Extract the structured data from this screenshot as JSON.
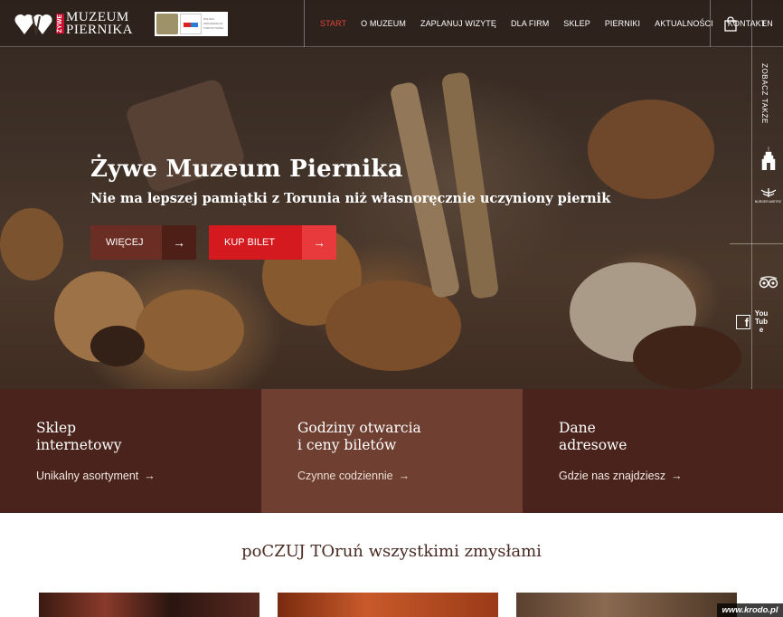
{
  "header": {
    "logo_word_top": "MUZEUM",
    "logo_word_bottom": "PIERNIKA",
    "logo_badge": "ŻYWE",
    "partner_note": "POLSKA ORGANIZACJA TURYSTYCZNA",
    "nav": [
      {
        "label": "START",
        "active": true
      },
      {
        "label": "O MUZEUM",
        "active": false
      },
      {
        "label": "ZAPLANUJ WIZYTĘ",
        "active": false
      },
      {
        "label": "DLA FIRM",
        "active": false
      },
      {
        "label": "SKLEP",
        "active": false
      },
      {
        "label": "PIERNIKI",
        "active": false
      },
      {
        "label": "AKTUALNOŚCI",
        "active": false
      },
      {
        "label": "KONTAKT",
        "active": false
      }
    ],
    "language": "EN",
    "cart_icon": "shopping-bag-icon"
  },
  "side_panel": {
    "label": "ZOBACZ TAKŻE",
    "icons": [
      "castle-icon",
      "burger-mistrz-icon",
      "tripadvisor-icon",
      "facebook-icon",
      "youtube-icon"
    ],
    "burger_caption": "BURGER-MISTRZ",
    "youtube_label": "You Tube"
  },
  "hero": {
    "title": "Żywe Muzeum Piernika",
    "subtitle": "Nie ma lepszej pamiątki z Torunia niż własnoręcznie uczyniony piernik",
    "more_button": "WIĘCEJ",
    "ticket_button": "KUP BILET",
    "arrow": "→"
  },
  "tiles": [
    {
      "title_line1": "Sklep",
      "title_line2": "internetowy",
      "link": "Unikalny asortyment"
    },
    {
      "title_line1": "Godziny otwarcia",
      "title_line2": "i ceny biletów",
      "link": "Czynne codziennie"
    },
    {
      "title_line1": "Dane",
      "title_line2": "adresowe",
      "link": "Gdzie nas znajdziesz"
    }
  ],
  "section": {
    "title": "poCZUJ TOruń wszystkimi zmysłami"
  },
  "watermark": "www.krodo.pl",
  "colors": {
    "accent_red": "#d41a1f",
    "active_nav": "#e0423a",
    "brown_dark": "#4a241c",
    "brown_mid": "#6f4032"
  }
}
